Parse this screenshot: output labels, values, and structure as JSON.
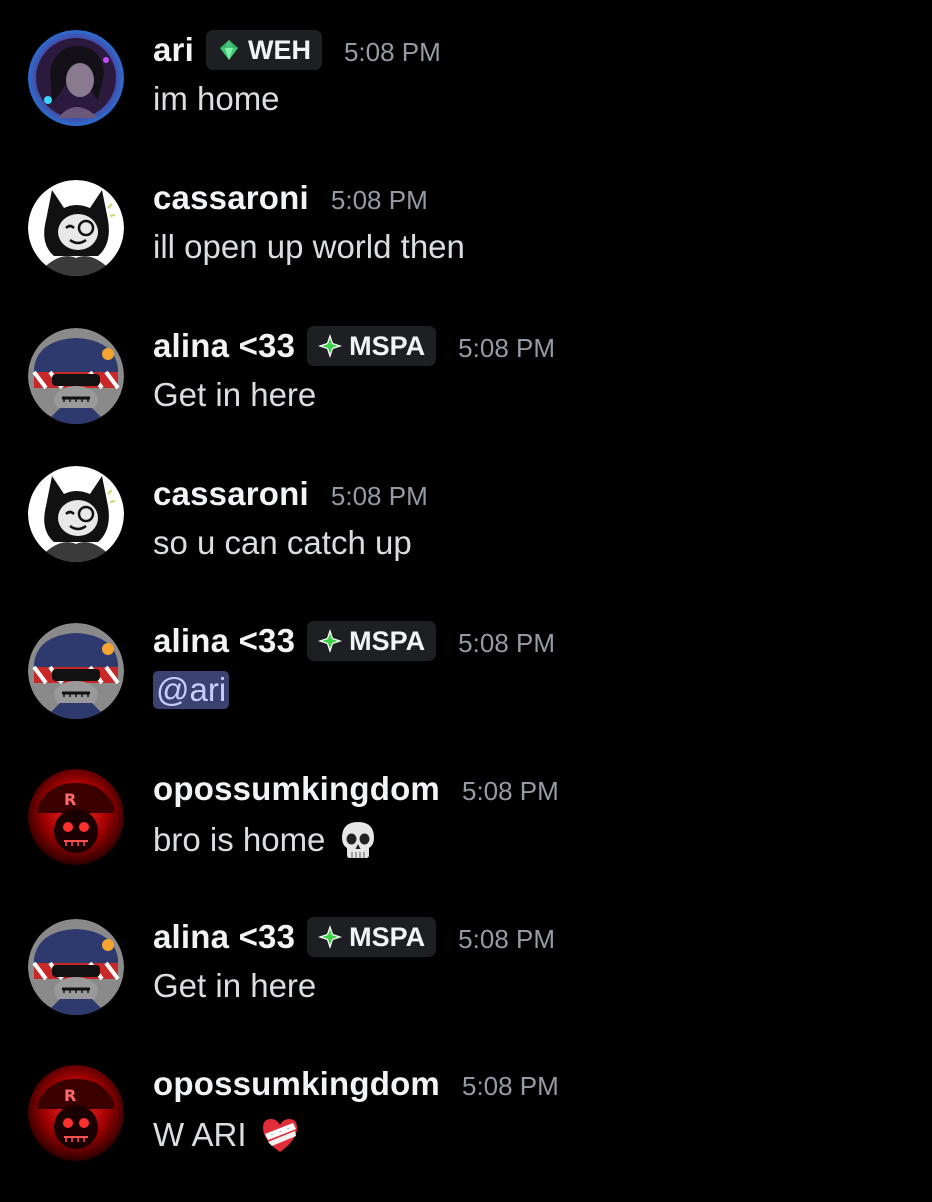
{
  "messages": [
    {
      "username": "ari",
      "tag": "WEH",
      "tag_icon": "green-gem-icon",
      "time": "5:08 PM",
      "text": "im home",
      "avatar": "ari-avatar"
    },
    {
      "username": "cassaroni",
      "time": "5:08 PM",
      "text": "ill open up world then",
      "avatar": "cassaroni-avatar"
    },
    {
      "username": "alina <33",
      "tag": "MSPA",
      "tag_icon": "green-star-icon",
      "time": "5:08 PM",
      "text": "Get in here",
      "avatar": "alina-avatar"
    },
    {
      "username": "cassaroni",
      "time": "5:08 PM",
      "text": "so u can catch up",
      "avatar": "cassaroni-avatar"
    },
    {
      "username": "alina <33",
      "tag": "MSPA",
      "tag_icon": "green-star-icon",
      "time": "5:08 PM",
      "mention": "@ari",
      "avatar": "alina-avatar"
    },
    {
      "username": "opossumkingdom",
      "time": "5:08 PM",
      "text": "bro is home",
      "emoji": "skull-emoji-icon",
      "avatar": "opossumkingdom-avatar"
    },
    {
      "username": "alina <33",
      "tag": "MSPA",
      "tag_icon": "green-star-icon",
      "time": "5:08 PM",
      "text": "Get in here",
      "avatar": "alina-avatar"
    },
    {
      "username": "opossumkingdom",
      "time": "5:08 PM",
      "text": "W ARI",
      "emoji": "mending-heart-emoji-icon",
      "avatar": "opossumkingdom-avatar"
    }
  ],
  "colors": {
    "background": "#000000",
    "username": "#f2f3f5",
    "timestamp": "#949ba4",
    "message_text": "#dbdee1",
    "tag_background": "#1e1f22",
    "mention_background": "#3c4270",
    "mention_text": "#c9cdfb"
  }
}
